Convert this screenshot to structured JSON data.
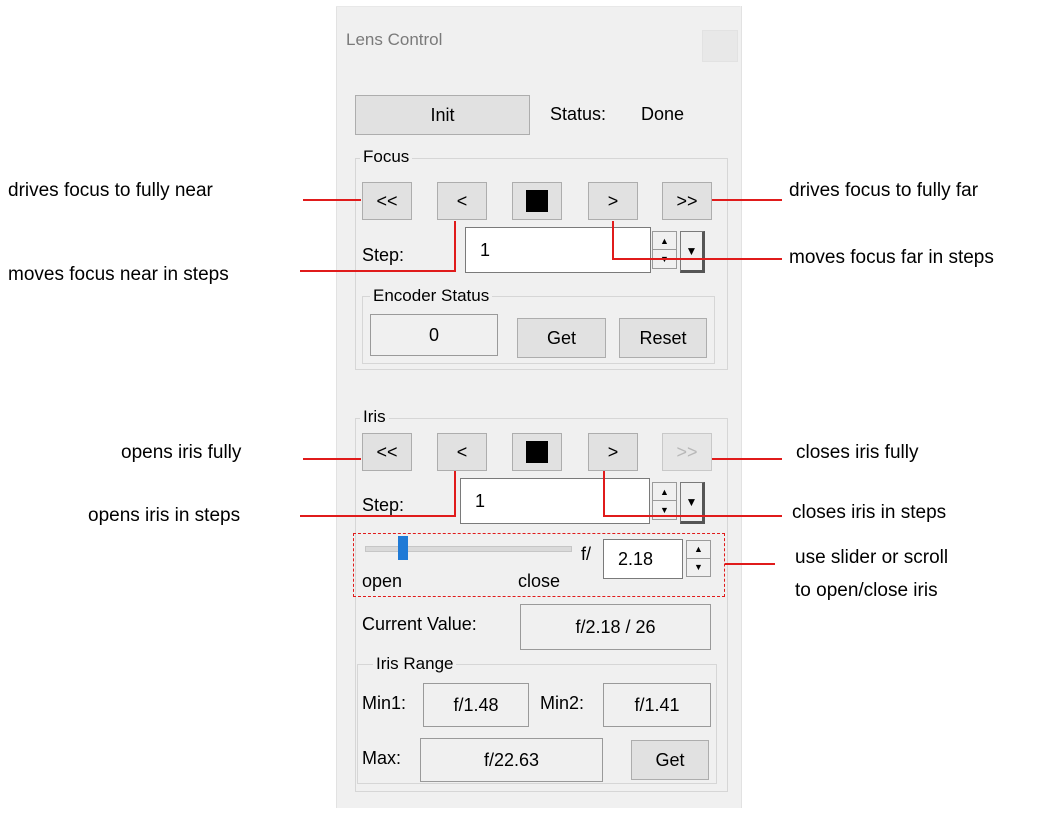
{
  "window": {
    "title": "Lens Control"
  },
  "init": {
    "button_label": "Init",
    "status_label": "Status:",
    "status_value": "Done"
  },
  "focus": {
    "group_label": "Focus",
    "buttons": {
      "full_near": "<<",
      "step_near": "<",
      "step_far": ">",
      "full_far": ">>"
    },
    "step_label": "Step:",
    "step_value": "1",
    "encoder": {
      "group_label": "Encoder Status",
      "value": "0",
      "get_label": "Get",
      "reset_label": "Reset"
    }
  },
  "iris": {
    "group_label": "Iris",
    "buttons": {
      "full_open": "<<",
      "step_open": "<",
      "step_close": ">",
      "full_close": ">>"
    },
    "step_label": "Step:",
    "step_value": "1",
    "slider": {
      "open_label": "open",
      "close_label": "close",
      "f_prefix": "f/",
      "f_value": "2.18",
      "position_fraction": 0.17
    },
    "current_value_label": "Current Value:",
    "current_value": "f/2.18 / 26",
    "range": {
      "group_label": "Iris Range",
      "min1_label": "Min1:",
      "min1_value": "f/1.48",
      "min2_label": "Min2:",
      "min2_value": "f/1.41",
      "max_label": "Max:",
      "max_value": "f/22.63",
      "get_label": "Get"
    }
  },
  "annotations": {
    "focus_full_near": "drives focus to fully near",
    "focus_full_far": "drives focus to fully far",
    "focus_step_near": "moves focus near in steps",
    "focus_step_far": "moves focus far in steps",
    "iris_full_open": "opens iris fully",
    "iris_full_close": "closes iris fully",
    "iris_step_open": "opens iris in steps",
    "iris_step_close": "closes iris in steps",
    "slider_line1": "use slider or scroll",
    "slider_line2": "to open/close iris"
  },
  "colors": {
    "annotation_line": "#e01b1b",
    "panel_bg": "#f0f0f0",
    "slider_thumb": "#1f7ad6"
  }
}
